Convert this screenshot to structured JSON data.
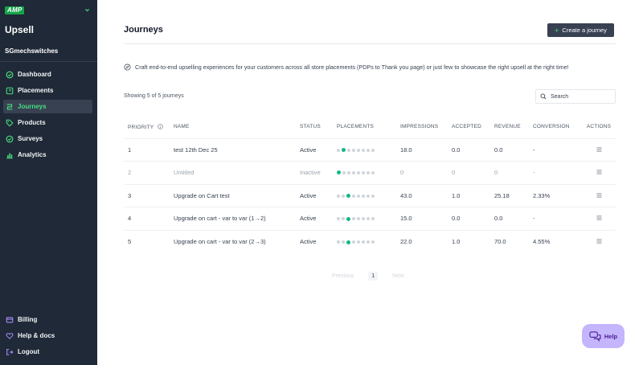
{
  "sidebar": {
    "brand": "AMP",
    "app_title": "Upsell",
    "shop_name": "SGmechswitches",
    "items": [
      {
        "label": "Dashboard"
      },
      {
        "label": "Placements"
      },
      {
        "label": "Journeys"
      },
      {
        "label": "Products"
      },
      {
        "label": "Surveys"
      },
      {
        "label": "Analytics"
      }
    ],
    "bottom_items": [
      {
        "label": "Billing"
      },
      {
        "label": "Help & docs"
      },
      {
        "label": "Logout"
      }
    ]
  },
  "header": {
    "title": "Journeys",
    "create_label": "Create a journey"
  },
  "description": "Craft end-to-end upselling experiences for your customers across all store placements (PDPs to Thank you page) or just few to showcase the right upsell at the right time!",
  "showing": "Showing 5 of 5 journeys",
  "search": {
    "placeholder": "Search"
  },
  "table": {
    "columns": {
      "priority": "PRIORITY",
      "name": "NAME",
      "status": "STATUS",
      "placements": "PLACEMENTS",
      "impressions": "IMPRESSIONS",
      "accepted": "ACCEPTED",
      "revenue": "REVENUE",
      "conversion": "CONVERSION",
      "actions": "ACTIONS"
    },
    "rows": [
      {
        "priority": "1",
        "name": "test 12th Dec 25",
        "status": "Active",
        "placement_active": 1,
        "impressions": "18.0",
        "accepted": "0.0",
        "revenue": "0.0",
        "conversion": "-"
      },
      {
        "priority": "2",
        "name": "Untitled",
        "status": "Inactive",
        "placement_active": 0,
        "impressions": "0",
        "accepted": "0",
        "revenue": "0",
        "conversion": "-"
      },
      {
        "priority": "3",
        "name": "Upgrade on Cart test",
        "status": "Active",
        "placement_active": 2,
        "impressions": "43.0",
        "accepted": "1.0",
        "revenue": "25.18",
        "conversion": "2.33%"
      },
      {
        "priority": "4",
        "name": "Upgrade on cart - var to var (1→2)",
        "status": "Active",
        "placement_active": 2,
        "impressions": "15.0",
        "accepted": "0.0",
        "revenue": "0.0",
        "conversion": "-"
      },
      {
        "priority": "5",
        "name": "Upgrade on cart - var to var (2→3)",
        "status": "Active",
        "placement_active": 2,
        "impressions": "22.0",
        "accepted": "1.0",
        "revenue": "70.0",
        "conversion": "4.55%"
      }
    ]
  },
  "pagination": {
    "previous": "Previous",
    "page": "1",
    "next": "Next"
  },
  "help_label": "Help",
  "colors": {
    "sidebar_bg": "#1f2937",
    "accent": "#4ade80",
    "dot_on": "#10b981",
    "help_bg": "#c4b5fd"
  },
  "icons": {
    "dashboard": "gauge-icon",
    "placements": "layout-icon",
    "journeys": "journey-icon",
    "products": "tag-icon",
    "surveys": "check-circle-icon",
    "analytics": "bar-chart-icon",
    "billing": "card-icon",
    "help": "heart-icon",
    "logout": "logout-icon"
  }
}
